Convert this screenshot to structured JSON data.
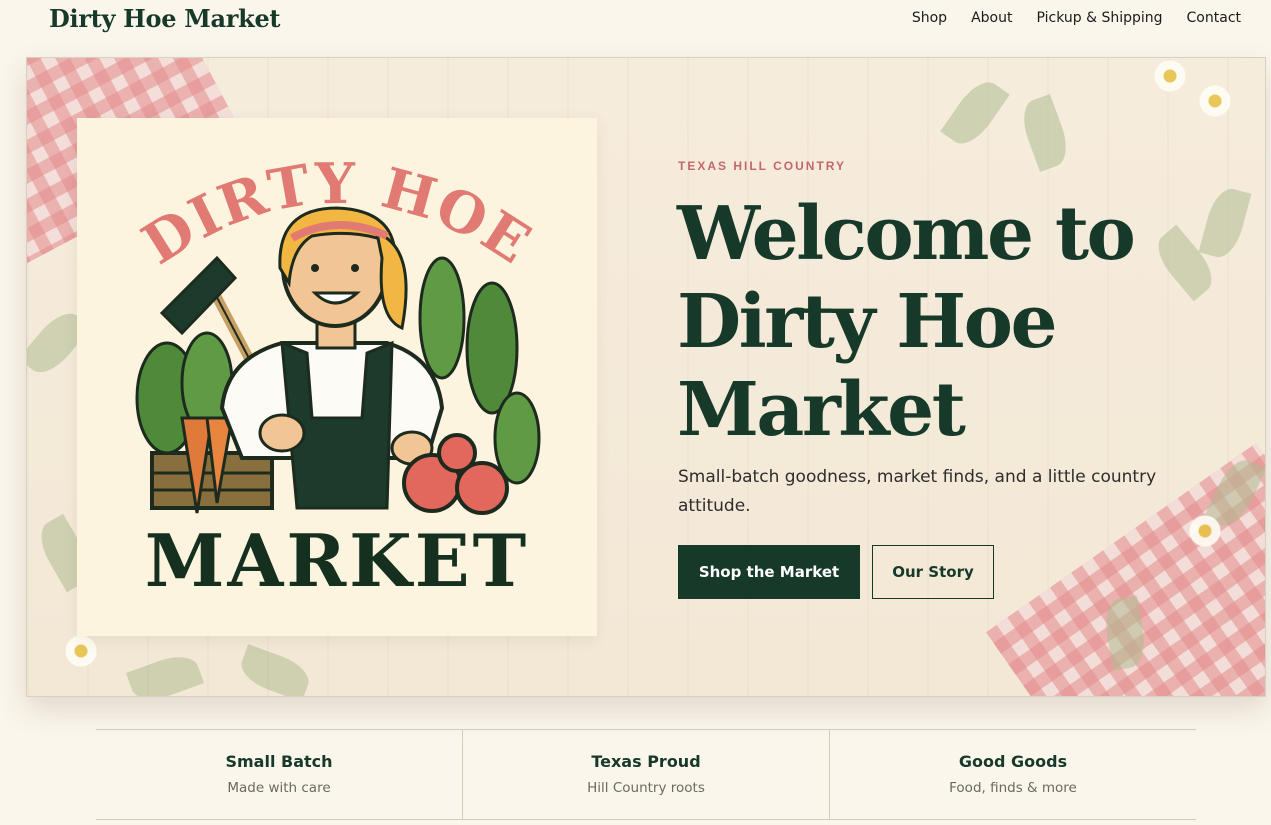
{
  "header": {
    "brand": "Dirty Hoe Market",
    "nav": [
      {
        "label": "Shop"
      },
      {
        "label": "About"
      },
      {
        "label": "Pickup & Shipping"
      },
      {
        "label": "Contact"
      }
    ]
  },
  "hero": {
    "logo": {
      "arc_text": "DIRTY HOE",
      "word": "MARKET"
    },
    "eyebrow": "TEXAS HILL COUNTRY",
    "headline": "Welcome to Dirty Hoe Market",
    "tagline": "Small-batch goodness, market finds, and a little country attitude.",
    "primary_cta": "Shop the Market",
    "secondary_cta": "Our Story"
  },
  "features": [
    {
      "title": "Small Batch",
      "subtitle": "Made with care"
    },
    {
      "title": "Texas Proud",
      "subtitle": "Hill Country roots"
    },
    {
      "title": "Good Goods",
      "subtitle": "Food, finds & more"
    }
  ],
  "colors": {
    "brand_green": "#17392a",
    "accent_pink": "#c2676a",
    "background": "#fbf6ec",
    "card": "#fdf4df"
  }
}
